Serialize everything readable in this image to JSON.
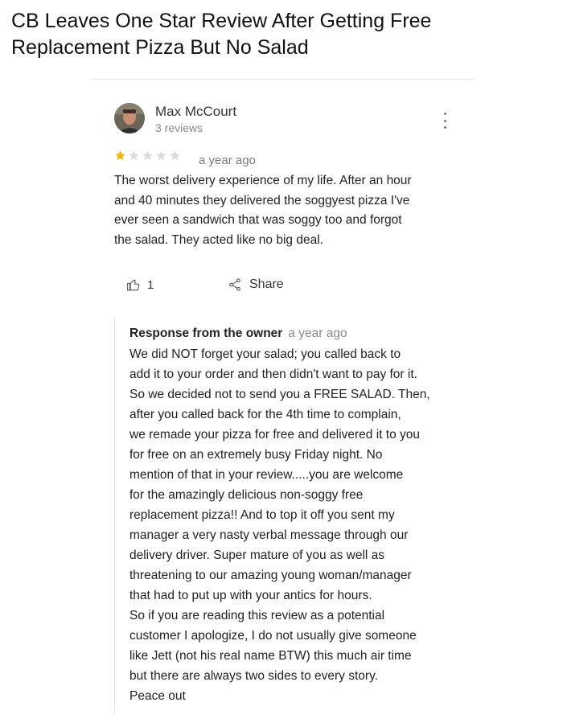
{
  "headline": {
    "line1": "CB Leaves One Star Review After Getting Free",
    "line2": "Replacement Pizza But No Salad"
  },
  "review": {
    "author": "Max McCourt",
    "author_reviews": "3 reviews",
    "rating": 1,
    "rating_max": 5,
    "star_color": "#f4b400",
    "empty_star_color": "#dadce0",
    "date": "a year ago",
    "text_lines": [
      "The worst delivery experience of my life. After an hour",
      "and 40 minutes they delivered the soggyest pizza I've",
      "ever seen a sandwich that was soggy too and forgot",
      "the salad. They acted like no big deal."
    ],
    "like_count": "1",
    "share_label": "Share"
  },
  "owner_response": {
    "title": "Response from the owner",
    "date": "a year ago",
    "lines": [
      "We did NOT forget your salad; you called back to",
      "add it to your order and then didn't want to pay for it.",
      "So we decided not to send you a FREE SALAD. Then,",
      "after you called back for the 4th time to complain,",
      "we remade your pizza for free and delivered it to you",
      "for free on an extremely busy Friday night. No",
      "mention of that in your review.....you are welcome",
      "for the amazingly delicious non-soggy free",
      "replacement pizza!!  And to top it off you sent my",
      "manager a very nasty verbal message through our",
      "delivery driver. Super mature of you as well as",
      "threatening to our amazing young woman/manager",
      "that had to put up with your antics for hours.",
      "So if you are reading this review as a potential",
      "customer I apologize, I do not usually give someone",
      "like Jett (not his real name BTW) this much air time",
      "but there are always two sides to every story.",
      "Peace out"
    ]
  }
}
